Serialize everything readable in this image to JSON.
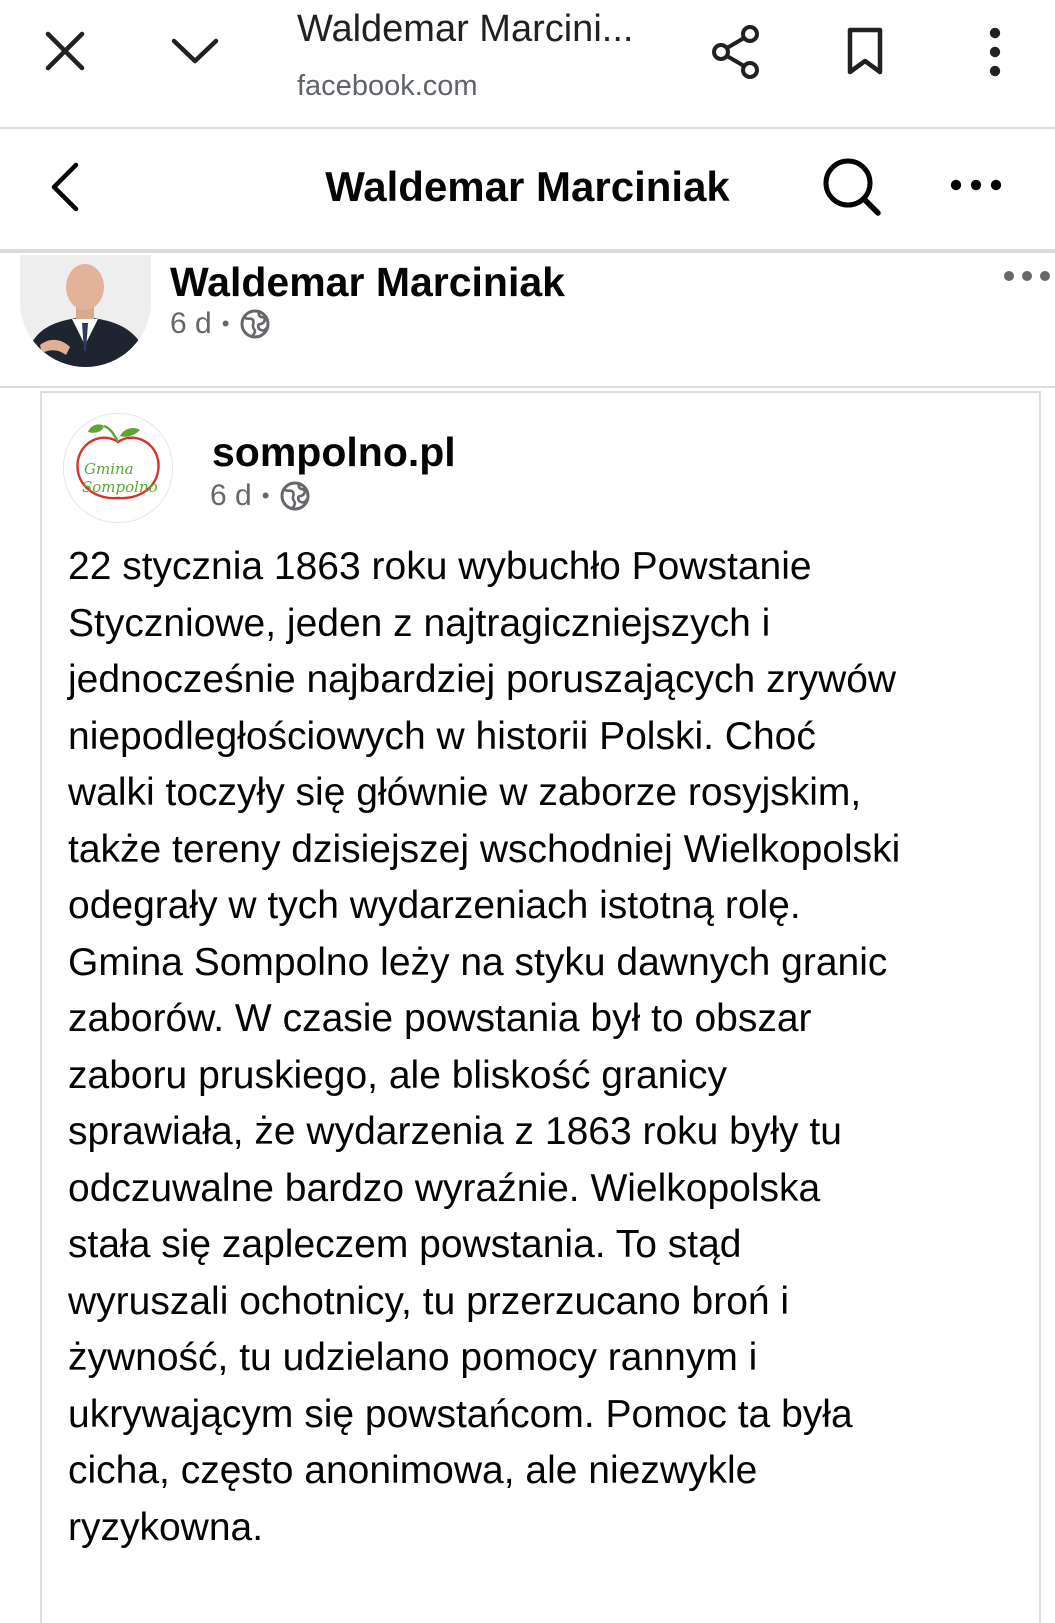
{
  "browser": {
    "title": "Waldemar Marcini...",
    "url": "facebook.com",
    "icons": [
      "close-icon",
      "chevron-down-icon",
      "share-icon",
      "bookmark-icon",
      "more-vert-icon"
    ]
  },
  "header": {
    "title": "Waldemar Marciniak",
    "icons": [
      "back-icon",
      "search-icon",
      "more-horizontal-icon"
    ]
  },
  "post": {
    "author": "Waldemar Marciniak",
    "time": "6 d",
    "separator": "•",
    "audience_icon": "globe-icon"
  },
  "shared": {
    "page_name": "sompolno.pl",
    "logo_text_line1": "Gmina",
    "logo_text_line2": "Sompolno",
    "time": "6 d",
    "separator": "•",
    "audience_icon": "globe-icon",
    "text_lines": [
      "22 stycznia 1863 roku wybuchło Powstanie",
      "Styczniowe, jeden z najtragiczniejszych i",
      "jednocześnie najbardziej poruszających zrywów",
      "niepodległościowych w historii Polski. Choć",
      "walki toczyły się głównie w zaborze rosyjskim,",
      "także tereny dzisiejszej wschodniej Wielkopolski",
      "odegrały w tych wydarzeniach istotną rolę.",
      "Gmina Sompolno leży na styku dawnych granic",
      "zaborów. W czasie powstania był to obszar",
      "zaboru pruskiego, ale bliskość granicy",
      "sprawiała, że wydarzenia z 1863 roku były tu",
      "odczuwalne bardzo wyraźnie. Wielkopolska",
      "stała się zapleczem powstania. To stąd",
      "wyruszali ochotnicy, tu przerzucano broń i",
      "żywność, tu udzielano pomocy rannym i",
      "ukrywającym się powstańcom. Pomoc ta była",
      "cicha, często anonimowa, ale niezwykle",
      "ryzykowna."
    ]
  },
  "colors": {
    "text": "#050505",
    "secondary": "#65676b",
    "divider": "#dadde1",
    "logo_green": "#5aa832",
    "logo_red": "#d9312b"
  }
}
